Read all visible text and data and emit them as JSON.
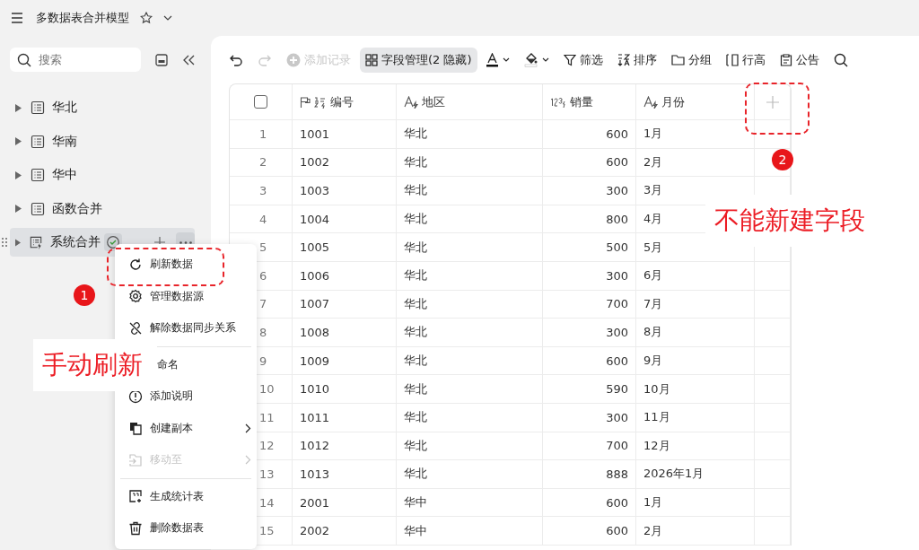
{
  "header": {
    "title": "多数据表合并模型"
  },
  "sidebar": {
    "search": {
      "placeholder": "搜索"
    },
    "items": [
      {
        "label": "华北",
        "kind": "table",
        "selected": false
      },
      {
        "label": "华南",
        "kind": "table",
        "selected": false
      },
      {
        "label": "华中",
        "kind": "table",
        "selected": false
      },
      {
        "label": "函数合并",
        "kind": "table",
        "selected": false
      },
      {
        "label": "系统合并",
        "kind": "synced",
        "selected": true
      }
    ]
  },
  "toolbar": [
    {
      "kind": "undo",
      "disabled": false
    },
    {
      "kind": "redo",
      "disabled": true
    },
    {
      "kind": "add",
      "label": "添加记录",
      "disabled": true
    },
    {
      "kind": "fields",
      "label": "字段管理(2 隐藏)",
      "disabled": false
    },
    {
      "kind": "text-color",
      "disabled": false
    },
    {
      "kind": "fill-color",
      "disabled": false
    },
    {
      "kind": "filter",
      "label": "筛选",
      "disabled": false
    },
    {
      "kind": "sort",
      "label": "排序",
      "disabled": false
    },
    {
      "kind": "group",
      "label": "分组",
      "disabled": false
    },
    {
      "kind": "row-height",
      "label": "行高",
      "disabled": false
    },
    {
      "kind": "notice",
      "label": "公告",
      "disabled": false
    },
    {
      "kind": "search",
      "disabled": false
    }
  ],
  "table": {
    "select_all": {
      "checked": false
    },
    "columns": [
      {
        "label": "编号",
        "kind": "autonumber",
        "primary": true
      },
      {
        "label": "地区",
        "kind": "text",
        "primary": false
      },
      {
        "label": "销量",
        "kind": "number",
        "primary": false
      },
      {
        "label": "月份",
        "kind": "text",
        "primary": false
      }
    ],
    "rows": [
      {
        "index": "1",
        "cells": [
          "1001",
          "华北",
          "600",
          "1月"
        ]
      },
      {
        "index": "2",
        "cells": [
          "1002",
          "华北",
          "600",
          "2月"
        ]
      },
      {
        "index": "3",
        "cells": [
          "1003",
          "华北",
          "300",
          "3月"
        ]
      },
      {
        "index": "4",
        "cells": [
          "1004",
          "华北",
          "800",
          "4月"
        ]
      },
      {
        "index": "5",
        "cells": [
          "1005",
          "华北",
          "500",
          "5月"
        ]
      },
      {
        "index": "6",
        "cells": [
          "1006",
          "华北",
          "300",
          "6月"
        ]
      },
      {
        "index": "7",
        "cells": [
          "1007",
          "华北",
          "700",
          "7月"
        ]
      },
      {
        "index": "8",
        "cells": [
          "1008",
          "华北",
          "300",
          "8月"
        ]
      },
      {
        "index": "9",
        "cells": [
          "1009",
          "华北",
          "600",
          "9月"
        ]
      },
      {
        "index": "10",
        "cells": [
          "1010",
          "华北",
          "590",
          "10月"
        ]
      },
      {
        "index": "11",
        "cells": [
          "1011",
          "华北",
          "300",
          "11月"
        ]
      },
      {
        "index": "12",
        "cells": [
          "1012",
          "华北",
          "700",
          "12月"
        ]
      },
      {
        "index": "13",
        "cells": [
          "1013",
          "华北",
          "888",
          "2026年1月"
        ]
      },
      {
        "index": "14",
        "cells": [
          "2001",
          "华中",
          "600",
          "1月"
        ]
      },
      {
        "index": "15",
        "cells": [
          "2002",
          "华中",
          "600",
          "2月"
        ]
      }
    ]
  },
  "context_menu": {
    "groups": [
      [
        {
          "kind": "refresh",
          "label": "刷新数据",
          "disabled": false,
          "submenu": false
        },
        {
          "kind": "settings",
          "label": "管理数据源",
          "disabled": false,
          "submenu": false
        },
        {
          "kind": "unlink",
          "label": "解除数据同步关系",
          "disabled": false,
          "submenu": false
        }
      ],
      [
        {
          "kind": "rename",
          "label": "命名",
          "disabled": false,
          "submenu": false
        },
        {
          "kind": "info",
          "label": "添加说明",
          "disabled": false,
          "submenu": false
        },
        {
          "kind": "copy",
          "label": "创建副本",
          "disabled": false,
          "submenu": true
        },
        {
          "kind": "move",
          "label": "移动至",
          "disabled": true,
          "submenu": true
        }
      ],
      [
        {
          "kind": "stats",
          "label": "生成统计表",
          "disabled": false,
          "submenu": false
        },
        {
          "kind": "trash",
          "label": "删除数据表",
          "disabled": false,
          "submenu": false
        }
      ]
    ]
  },
  "annotations": [
    {
      "kind": "frame"
    },
    {
      "kind": "frame"
    },
    {
      "kind": "badge",
      "text": "1"
    },
    {
      "kind": "badge",
      "text": "2"
    },
    {
      "kind": "callout",
      "text": "不能新建字段"
    },
    {
      "kind": "callout",
      "text": "手动刷新"
    }
  ]
}
